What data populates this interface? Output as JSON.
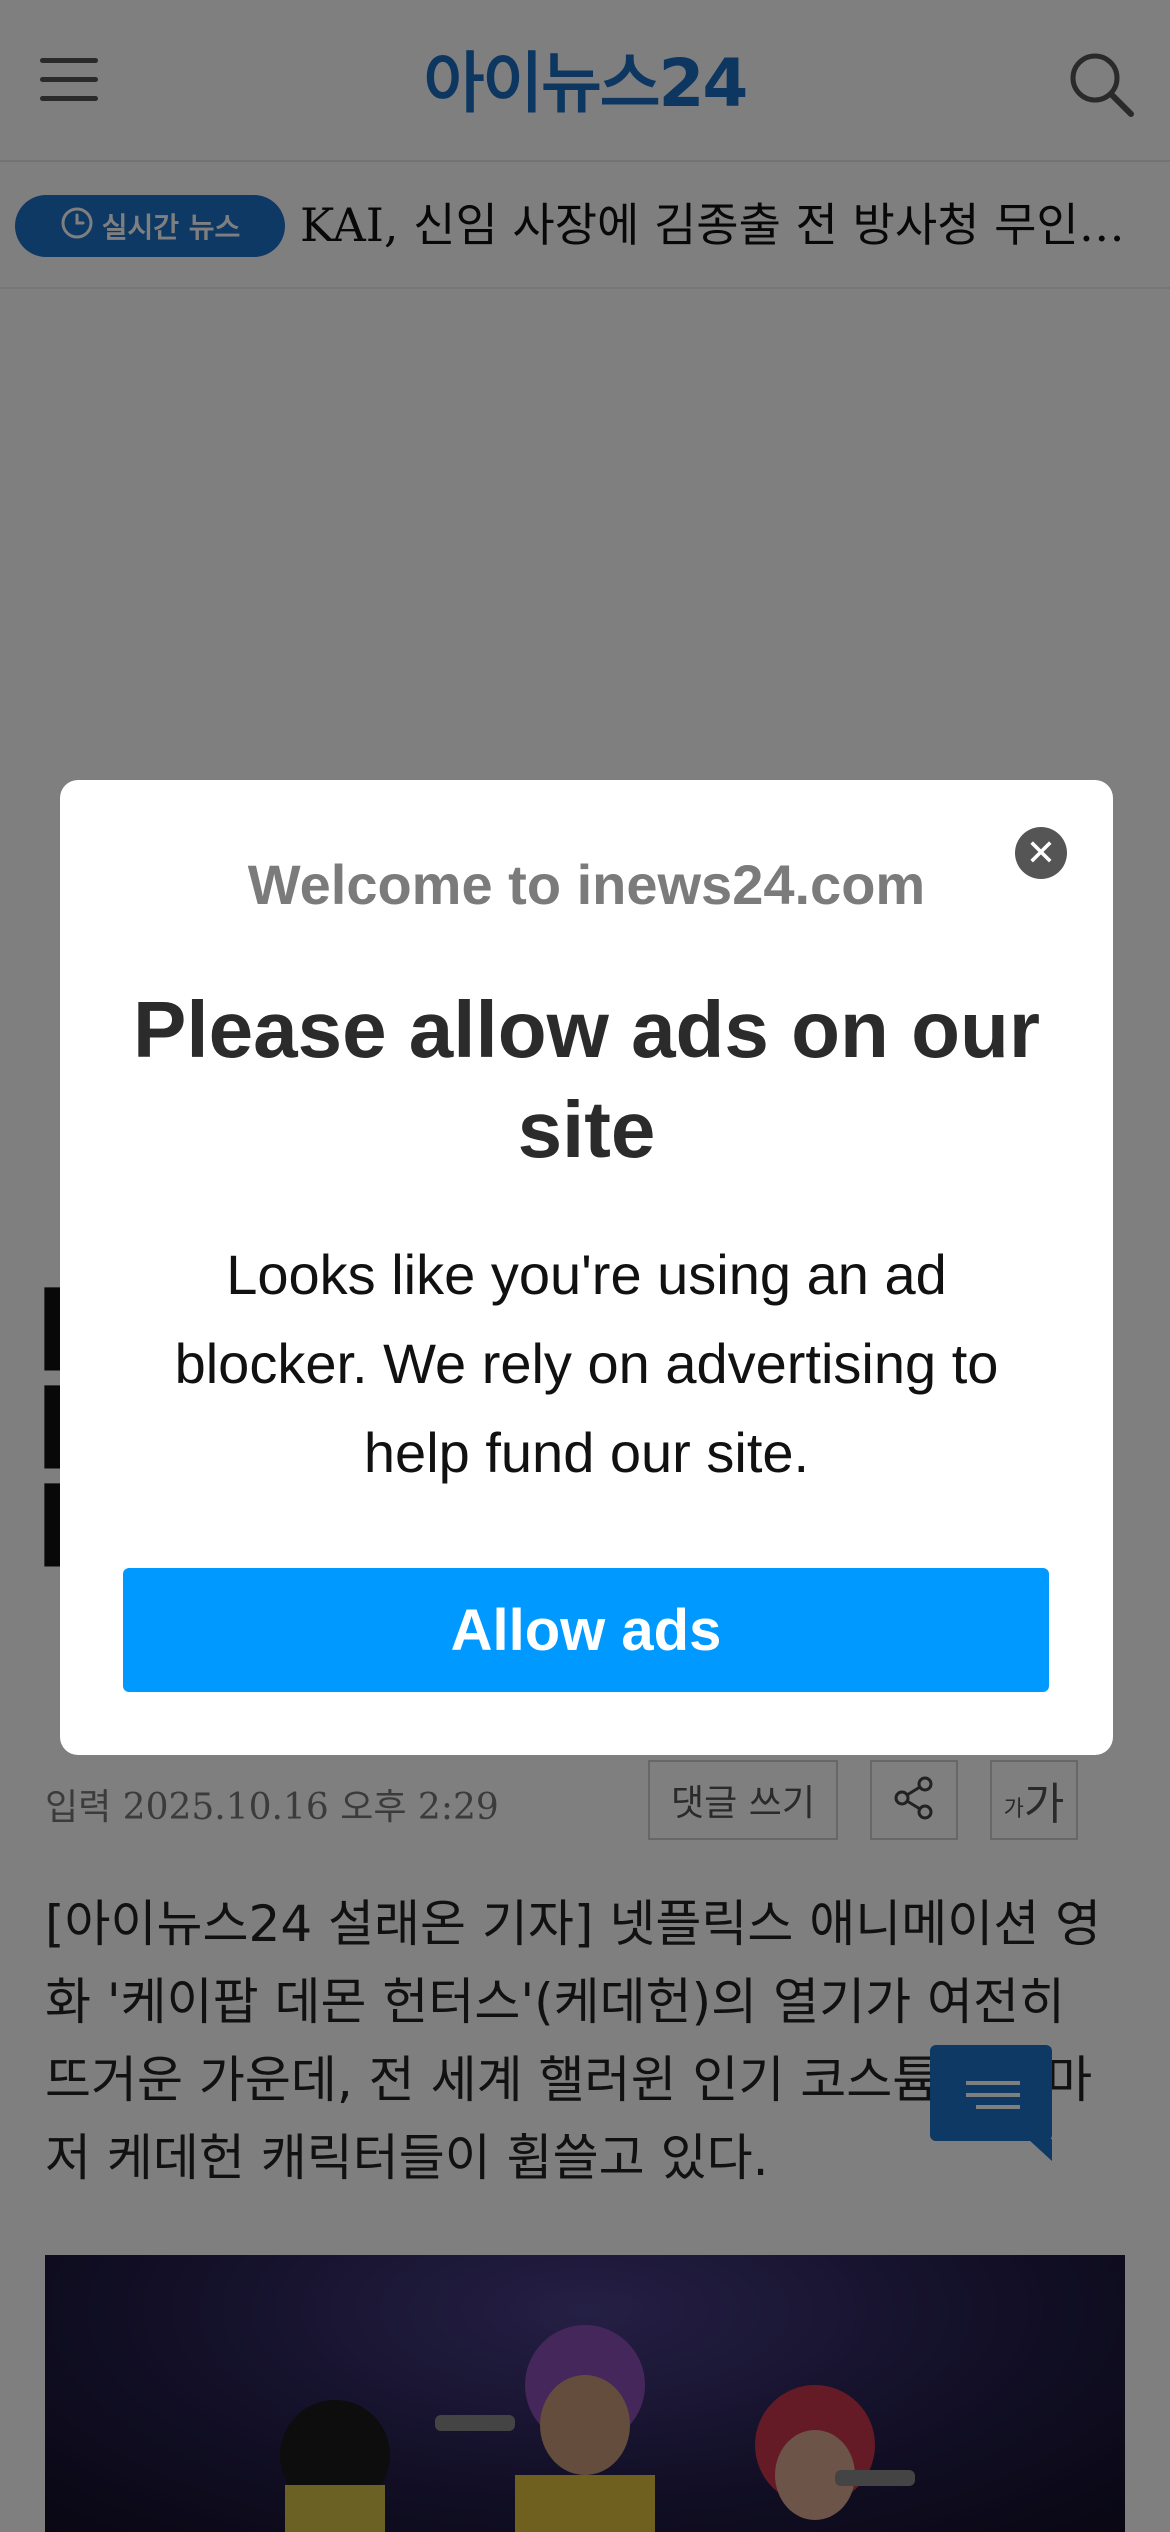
{
  "header": {
    "logo_text": "아이뉴스24"
  },
  "ticker": {
    "badge_label": "실시간 뉴스",
    "headline": "KAI, 신임 사장에 김종출 전 방사청 무인사..."
  },
  "article": {
    "date": "입력 2025.10.16 오후 2:29",
    "comment_button": "댓글 쓰기",
    "font_size_small": "가",
    "font_size_large": "가",
    "body": "[아이뉴스24 설래온 기자] 넷플릭스 애니메이션 영화 '케이팝 데몬 헌터스'(케데헌)의 열기가 여전히 뜨거운 가운데, 전 세계 핼러윈 인기 코스튬 순위마저 케데헌 캐릭터들이 휩쓸고 있다."
  },
  "modal": {
    "welcome": "Welcome to inews24.com",
    "heading": "Please allow ads on our site",
    "message": "Looks like you're using an ad blocker. We rely on advertising to help fund our site.",
    "allow_button": "Allow ads"
  },
  "colors": {
    "brand_blue": "#1b6fc2",
    "cta_blue": "#0099ff",
    "overlay": "rgba(0,0,0,0.5)"
  },
  "icons": {
    "menu": "hamburger-icon",
    "search": "search-icon",
    "clock": "clock-icon",
    "share": "share-icon",
    "close": "close-icon",
    "chat": "chat-icon"
  }
}
